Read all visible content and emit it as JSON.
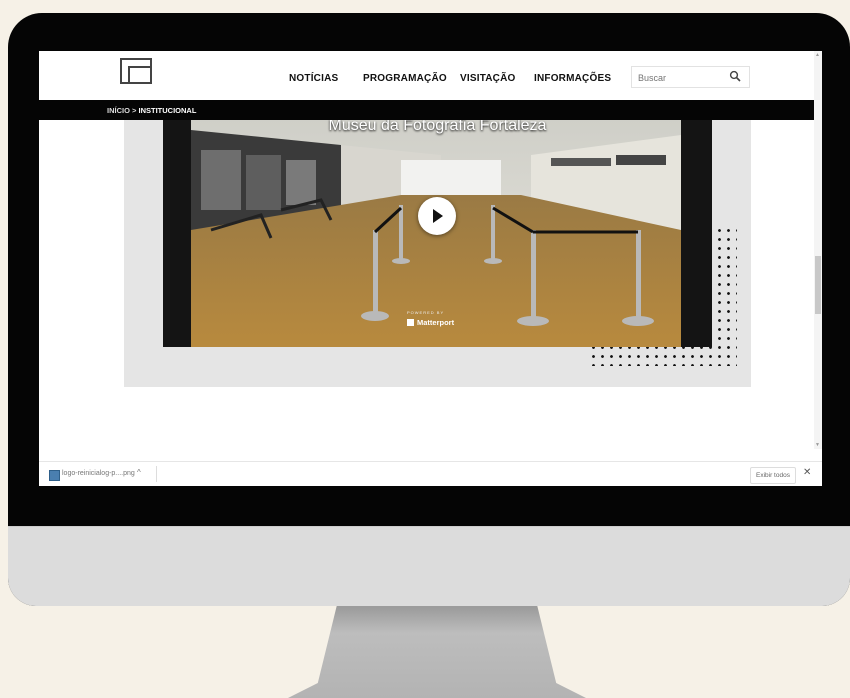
{
  "header": {
    "nav": [
      "NOTÍCIAS",
      "PROGRAMAÇÃO",
      "VISITAÇÃO",
      "INFORMAÇÕES"
    ],
    "search_placeholder": "Buscar"
  },
  "breadcrumb": {
    "home": "INÍCIO",
    "separator": ">",
    "current": "INSTITUCIONAL"
  },
  "video": {
    "title": "Museu da Fotografia Fortaleza",
    "powered_by": "POWERED BY",
    "brand": "Matterport"
  },
  "downloads": {
    "file_name": "logo-reinicialog-p....png",
    "chevron": "^",
    "show_all": "Exibir todos",
    "close": "✕"
  },
  "colors": {
    "background": "#f6f1e7",
    "bezel": "#050505",
    "panel": "#e5e5e5"
  }
}
